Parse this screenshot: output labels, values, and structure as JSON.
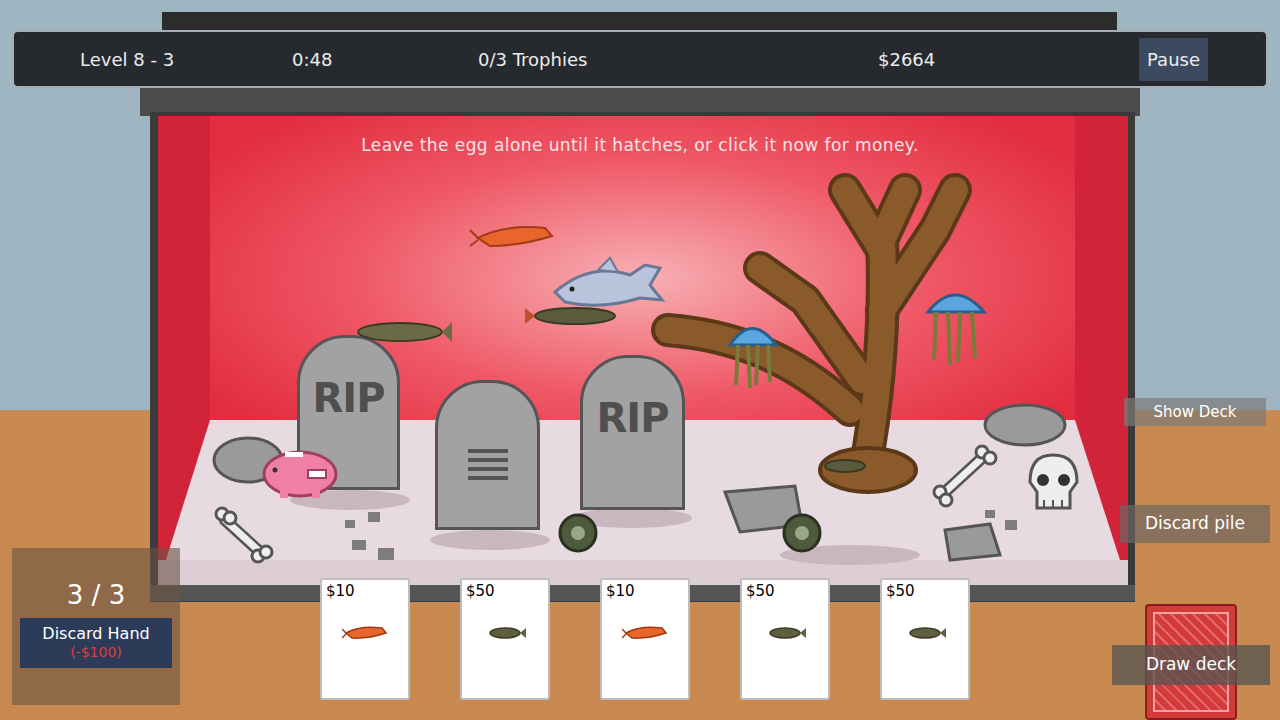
{
  "hud": {
    "level": "Level 8 - 3",
    "timer": "0:48",
    "trophies": "0/3 Trophies",
    "money": "$2664",
    "pause": "Pause"
  },
  "hint": "Leave the egg alone until it hatches, or click it now for money.",
  "tombstones": [
    {
      "kind": "rip",
      "text": "RIP"
    },
    {
      "kind": "scribble"
    },
    {
      "kind": "rip",
      "text": "RIP"
    }
  ],
  "hand": {
    "count": "3 / 3",
    "discard": {
      "label": "Discard Hand",
      "cost": "(-$100)"
    }
  },
  "cards": [
    {
      "price": "$10",
      "kind": "shrimp"
    },
    {
      "price": "$50",
      "kind": "fish"
    },
    {
      "price": "$10",
      "kind": "shrimp"
    },
    {
      "price": "$50",
      "kind": "fish"
    },
    {
      "price": "$50",
      "kind": "fish"
    }
  ],
  "side": {
    "show_deck": "Show Deck",
    "discard_pile": "Discard pile",
    "draw_deck": "Draw deck"
  }
}
